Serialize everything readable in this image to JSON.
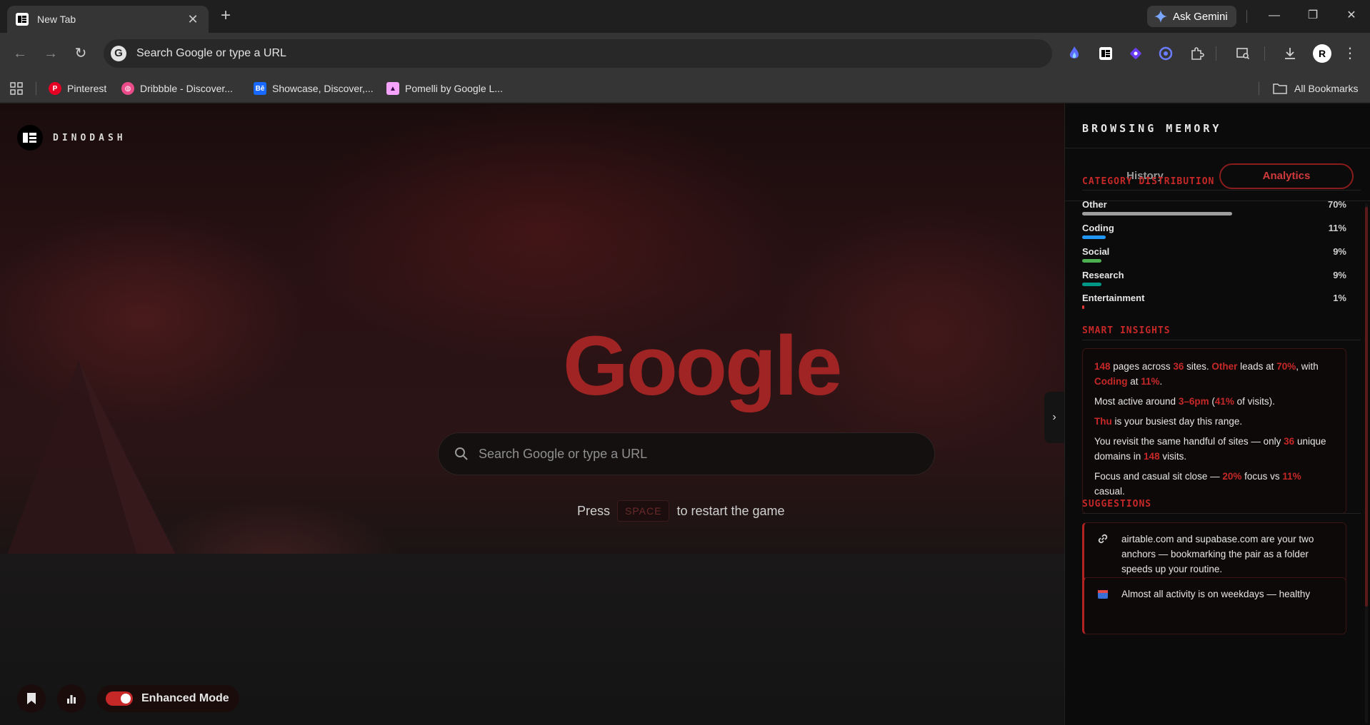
{
  "browser": {
    "tab_title": "New Tab",
    "gemini_label": "Ask Gemini",
    "omnibox_text": "Search Google or type a URL",
    "bookmarks": [
      {
        "label": "Pinterest",
        "icon": "pinterest-icon",
        "color": "#e60023"
      },
      {
        "label": "Dribbble - Discover...",
        "icon": "dribbble-icon",
        "color": "#ea4c89"
      },
      {
        "label": "Showcase, Discover,...",
        "icon": "behance-icon",
        "color": "#1769ff"
      },
      {
        "label": "Pomelli by Google L...",
        "icon": "pomelli-icon",
        "color": "#f5a3ff"
      }
    ],
    "all_bookmarks_label": "All Bookmarks",
    "avatar_letter": "R"
  },
  "page": {
    "brand_name": "DINODASH",
    "google_logo_text": "Google",
    "search_placeholder": "Search Google or type a URL",
    "restart_prefix": "Press",
    "restart_key": "SPACE",
    "restart_suffix": "to restart the game",
    "enhanced_mode_label": "Enhanced Mode",
    "accent_color": "#c62828"
  },
  "panel": {
    "title": "BROWSING MEMORY",
    "tabs": [
      {
        "label": "History",
        "active": false
      },
      {
        "label": "Analytics",
        "active": true
      }
    ],
    "category_title": "CATEGORY DISTRIBUTION",
    "categories": [
      {
        "label": "Other",
        "percent_label": "70%",
        "fraction": 0.7,
        "color": "#9e9e9e"
      },
      {
        "label": "Coding",
        "percent_label": "11%",
        "fraction": 0.11,
        "color": "#2196f3"
      },
      {
        "label": "Social",
        "percent_label": "9%",
        "fraction": 0.09,
        "color": "#4caf50"
      },
      {
        "label": "Research",
        "percent_label": "9%",
        "fraction": 0.09,
        "color": "#009688"
      },
      {
        "label": "Entertainment",
        "percent_label": "1%",
        "fraction": 0.01,
        "color": "#e53935"
      }
    ],
    "insights_title": "SMART INSIGHTS",
    "insights": {
      "i1": {
        "pages": "148",
        "t1": " pages across ",
        "sites": "36",
        "t2": " sites. ",
        "lead_cat": "Other",
        "t3": " leads at ",
        "lead_pct": "70%",
        "t4": ", with ",
        "second_cat": "Coding",
        "t5": " at ",
        "second_pct": "11%",
        "t6": "."
      },
      "i2": {
        "t1": "Most active around ",
        "time": "3–6pm",
        "t2": " (",
        "pct": "41%",
        "t3": " of visits)."
      },
      "i3": {
        "day": "Thu",
        "t1": " is your busiest day this range."
      },
      "i4": {
        "t1": "You revisit the same handful of sites — only ",
        "domains": "36",
        "t2": " unique domains in ",
        "visits": "148",
        "t3": " visits."
      },
      "i5": {
        "t1": "Focus and casual sit close — ",
        "focus": "20%",
        "t2": " focus vs ",
        "casual": "11%",
        "t3": " casual."
      }
    },
    "suggestions_title": "SUGGESTIONS",
    "suggestions": [
      {
        "icon": "link-icon",
        "text": "airtable.com and supabase.com are your two anchors — bookmarking the pair as a folder speeds up your routine."
      },
      {
        "icon": "calendar-icon",
        "text": "Almost all activity is on weekdays — healthy"
      }
    ]
  }
}
